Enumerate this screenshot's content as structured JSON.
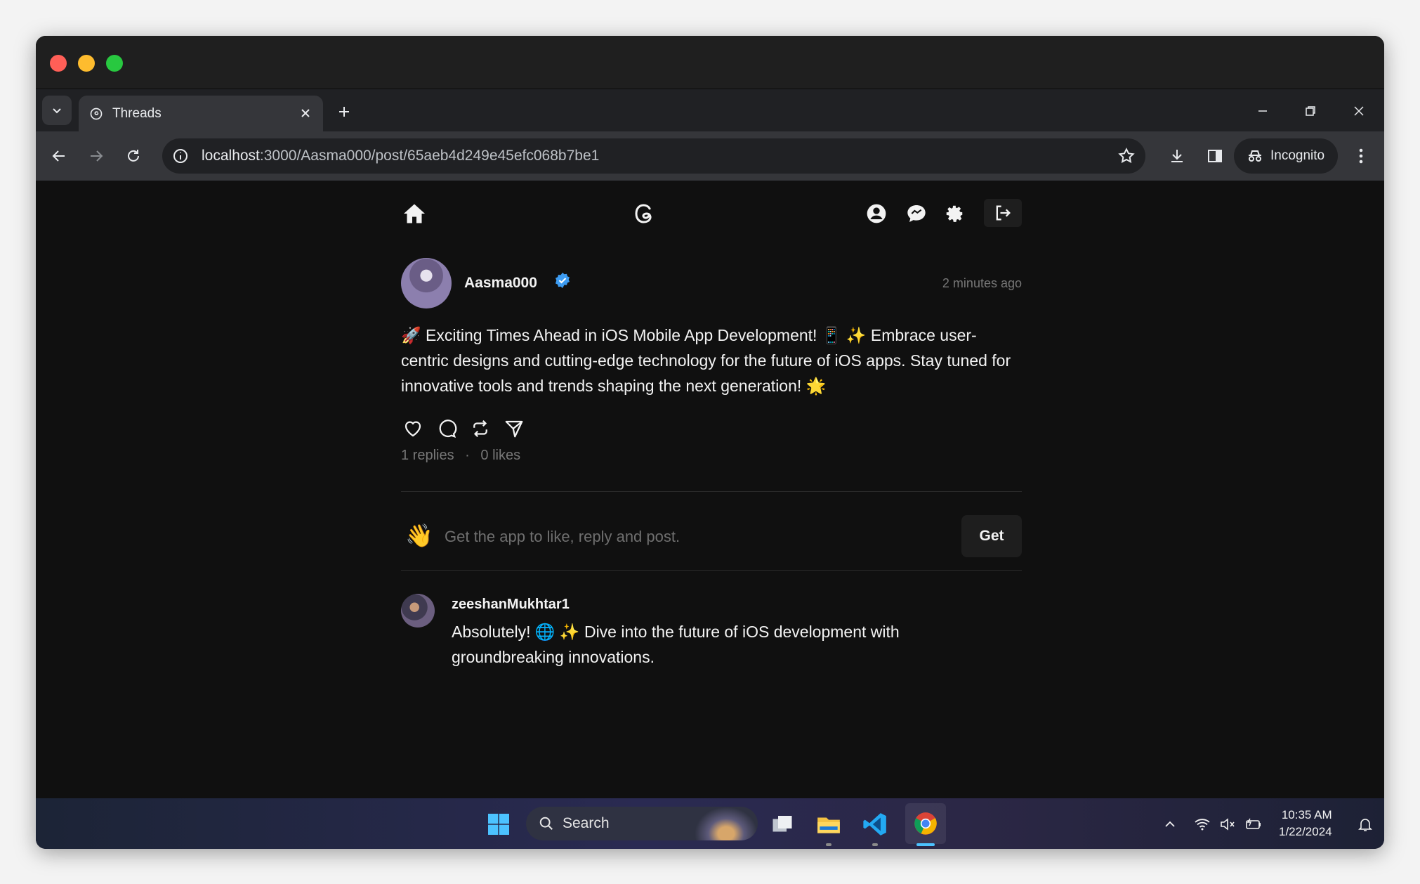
{
  "browser": {
    "tab_title": "Threads",
    "url_host": "localhost",
    "url_path": ":3000/Aasma000/post/65aeb4d249e45efc068b7be1",
    "incognito_label": "Incognito"
  },
  "nav": {
    "icons": [
      "home-icon",
      "threads-logo-icon",
      "profile-icon",
      "chat-icon",
      "settings-icon",
      "logout-icon"
    ]
  },
  "post": {
    "username": "Aasma000",
    "time": "2 minutes ago",
    "text": "🚀 Exciting Times Ahead in iOS Mobile App Development! 📱 ✨ Embrace user-centric designs and cutting-edge technology for the future of iOS apps. Stay tuned for innovative tools and trends shaping the next generation! 🌟",
    "replies": "1 replies",
    "separator": "·",
    "likes": "0 likes"
  },
  "promo": {
    "emoji": "👋",
    "text": "Get the app to like, reply and post.",
    "button": "Get"
  },
  "reply": {
    "username": "zeeshanMukhtar1",
    "text": "Absolutely! 🌐 ✨ Dive into the future of iOS development with groundbreaking innovations."
  },
  "taskbar": {
    "search_label": "Search",
    "time": "10:35 AM",
    "date": "1/22/2024"
  },
  "colors": {
    "accent_verified": "#3d9cf2",
    "background": "#101010",
    "text_primary": "#f3f3f3",
    "text_muted": "#777777"
  }
}
